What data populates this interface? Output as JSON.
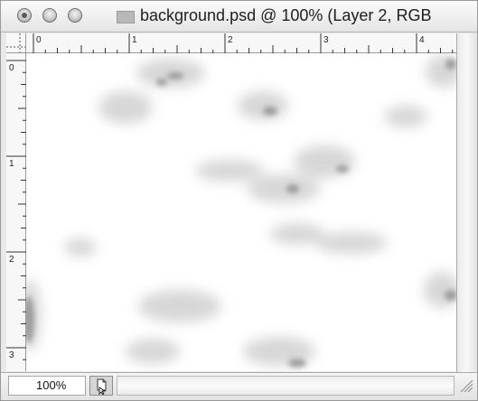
{
  "window": {
    "title": "background.psd @ 100% (Layer 2, RGB"
  },
  "rulers": {
    "horizontal_labels": [
      "0",
      "1",
      "2",
      "3",
      "4"
    ],
    "vertical_labels": [
      "0",
      "1",
      "2",
      "3"
    ],
    "unit": "inches"
  },
  "status": {
    "zoom": "100%"
  },
  "icons": {
    "close": "close-icon",
    "minimize": "minimize-icon",
    "zoom": "zoom-icon",
    "proxy": "document-proxy-icon",
    "doc_info": "document-info-icon",
    "resize": "resize-grip-icon"
  },
  "colors": {
    "canvas": "#ffffff",
    "chrome": "#e9e9e9"
  }
}
